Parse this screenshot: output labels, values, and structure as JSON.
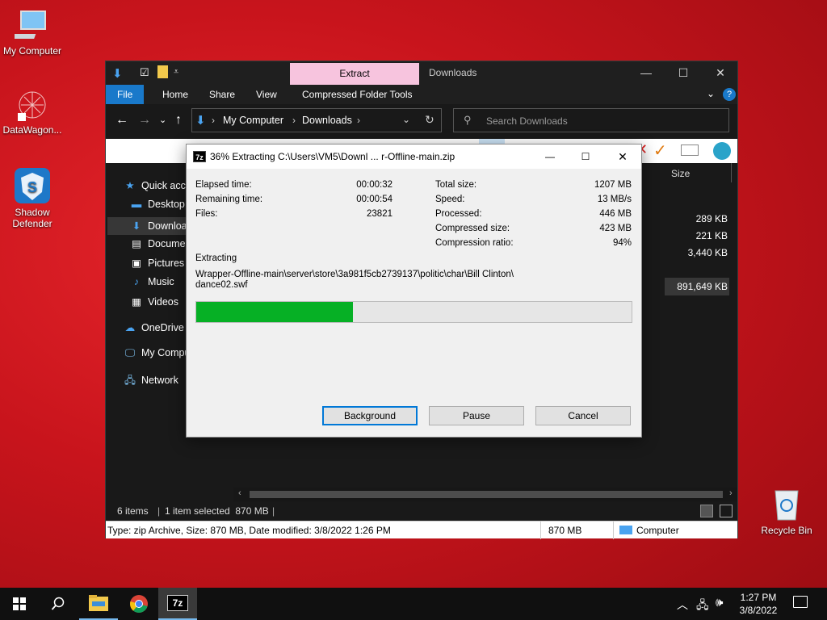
{
  "desktop": {
    "icons": [
      {
        "label": "My Computer",
        "icon": "computer-icon"
      },
      {
        "label": "DataWagon...",
        "icon": "datawagon-icon"
      },
      {
        "label": "Shadow Defender",
        "icon": "shadow-defender-icon"
      },
      {
        "label": "Recycle Bin",
        "icon": "recycle-bin-icon"
      }
    ]
  },
  "explorer": {
    "context_tab": "Extract",
    "title": "Downloads",
    "ribbon_tabs": [
      "File",
      "Home",
      "Share",
      "View",
      "Compressed Folder Tools"
    ],
    "breadcrumb": [
      "My Computer",
      "Downloads"
    ],
    "search_placeholder": "Search Downloads",
    "column_header": "Size",
    "nav_items": [
      {
        "label": "Quick access",
        "icon": "star-icon"
      },
      {
        "label": "Desktop",
        "icon": "desktop-folder-icon"
      },
      {
        "label": "Downloads",
        "icon": "downloads-icon"
      },
      {
        "label": "Documents",
        "icon": "documents-icon"
      },
      {
        "label": "Pictures",
        "icon": "pictures-icon"
      },
      {
        "label": "Music",
        "icon": "music-icon"
      },
      {
        "label": "Videos",
        "icon": "videos-icon"
      },
      {
        "label": "OneDrive",
        "icon": "cloud-icon"
      },
      {
        "label": "My Computer",
        "icon": "computer-icon"
      },
      {
        "label": "Network",
        "icon": "network-icon"
      }
    ],
    "sizes": [
      "289 KB",
      "221 KB",
      "3,440 KB",
      "891,649 KB"
    ],
    "status": {
      "items": "6 items",
      "selected": "1 item selected  870 MB"
    },
    "details": {
      "info": "Type: zip Archive, Size: 870 MB, Date modified: 3/8/2022 1:26 PM",
      "size": "870 MB",
      "location": "Computer"
    }
  },
  "dialog": {
    "title": "36% Extracting C:\\Users\\VM5\\Downl ... r-Offline-main.zip",
    "app_icon_text": "7z",
    "left_stats": [
      {
        "label": "Elapsed time:",
        "value": "00:00:32"
      },
      {
        "label": "Remaining time:",
        "value": "00:00:54"
      },
      {
        "label": "Files:",
        "value": "23821"
      }
    ],
    "right_stats": [
      {
        "label": "Total size:",
        "value": "1207 MB"
      },
      {
        "label": "Speed:",
        "value": "13 MB/s"
      },
      {
        "label": "Processed:",
        "value": "446 MB"
      },
      {
        "label": "Compressed size:",
        "value": "423 MB"
      },
      {
        "label": "Compression ratio:",
        "value": "94%"
      }
    ],
    "operation": "Extracting",
    "current_file_line1": "Wrapper-Offline-main\\server\\store\\3a981f5cb2739137\\politic\\char\\Bill Clinton\\",
    "current_file_line2": "dance02.swf",
    "progress": 0.36,
    "buttons": {
      "background": "Background",
      "pause": "Pause",
      "cancel": "Cancel"
    }
  },
  "taskbar": {
    "apps": [
      "start-icon",
      "search-icon",
      "file-explorer-icon",
      "chrome-icon",
      "7zip-icon"
    ],
    "app_7z_text": "7z",
    "time": "1:27 PM",
    "date": "3/8/2022"
  },
  "colors": {
    "progress": "#06b025",
    "accent": "#1979ca",
    "context_tab": "#f7c4de"
  }
}
